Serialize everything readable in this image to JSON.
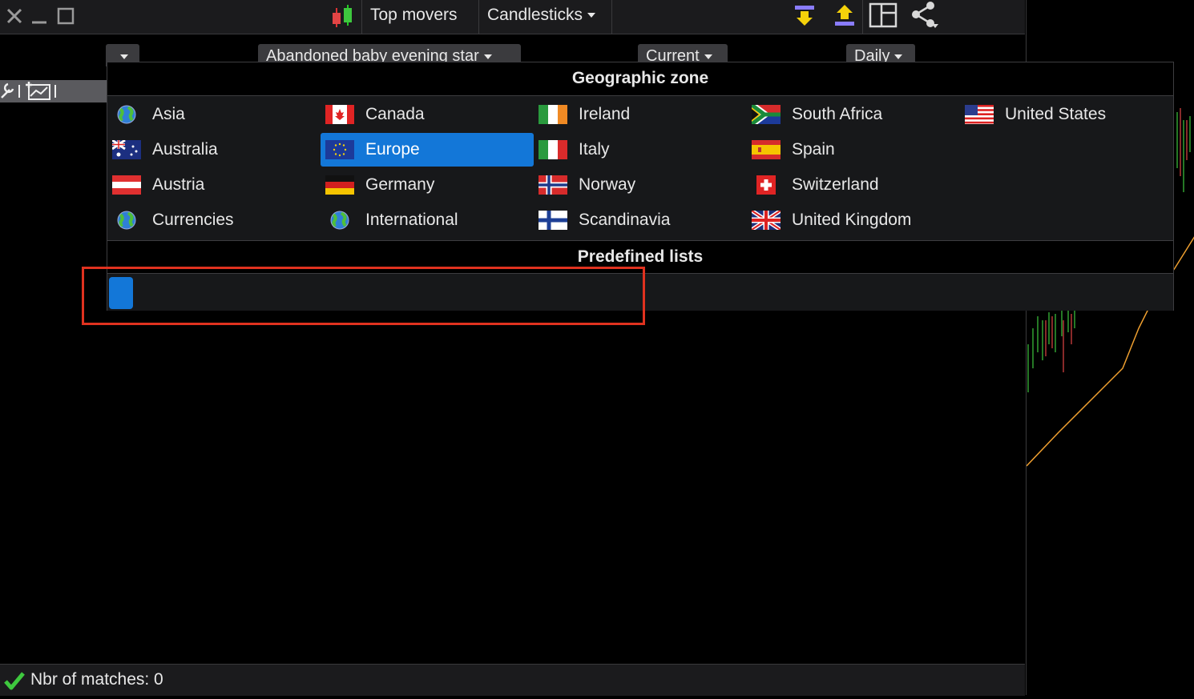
{
  "toolbar": {
    "top_movers_label": "Top movers",
    "chart_type_label": "Candlesticks"
  },
  "filters": {
    "pattern": "Abandoned baby evening star",
    "period": "Current",
    "interval": "Daily"
  },
  "popup": {
    "geo_header": "Geographic zone",
    "predefined_header": "Predefined lists",
    "selected": "Europe",
    "zones": [
      {
        "label": "Asia",
        "icon": "globe-icon",
        "col": 0,
        "row": 0
      },
      {
        "label": "Australia",
        "icon": "flag-australia-icon",
        "col": 0,
        "row": 1
      },
      {
        "label": "Austria",
        "icon": "flag-austria-icon",
        "col": 0,
        "row": 2
      },
      {
        "label": "Currencies",
        "icon": "globe-icon",
        "col": 0,
        "row": 3
      },
      {
        "label": "Canada",
        "icon": "flag-canada-icon",
        "col": 1,
        "row": 0
      },
      {
        "label": "Europe",
        "icon": "flag-eu-icon",
        "col": 1,
        "row": 1
      },
      {
        "label": "Germany",
        "icon": "flag-germany-icon",
        "col": 1,
        "row": 2
      },
      {
        "label": "International",
        "icon": "globe-icon",
        "col": 1,
        "row": 3
      },
      {
        "label": "Ireland",
        "icon": "flag-ireland-icon",
        "col": 2,
        "row": 0
      },
      {
        "label": "Italy",
        "icon": "flag-italy-icon",
        "col": 2,
        "row": 1
      },
      {
        "label": "Norway",
        "icon": "flag-norway-icon",
        "col": 2,
        "row": 2
      },
      {
        "label": "Scandinavia",
        "icon": "flag-finland-icon",
        "col": 2,
        "row": 3
      },
      {
        "label": "South Africa",
        "icon": "flag-south-africa-icon",
        "col": 3,
        "row": 0
      },
      {
        "label": "Spain",
        "icon": "flag-spain-icon",
        "col": 3,
        "row": 1
      },
      {
        "label": "Switzerland",
        "icon": "flag-switzerland-icon",
        "col": 3,
        "row": 2
      },
      {
        "label": "United Kingdom",
        "icon": "flag-uk-icon",
        "col": 3,
        "row": 3
      },
      {
        "label": "United States",
        "icon": "flag-usa-icon",
        "col": 4,
        "row": 0
      }
    ]
  },
  "status": {
    "matches_text": "Nbr of matches: 0"
  },
  "colors": {
    "accent": "#1377d8",
    "highlight": "#e0321f"
  }
}
